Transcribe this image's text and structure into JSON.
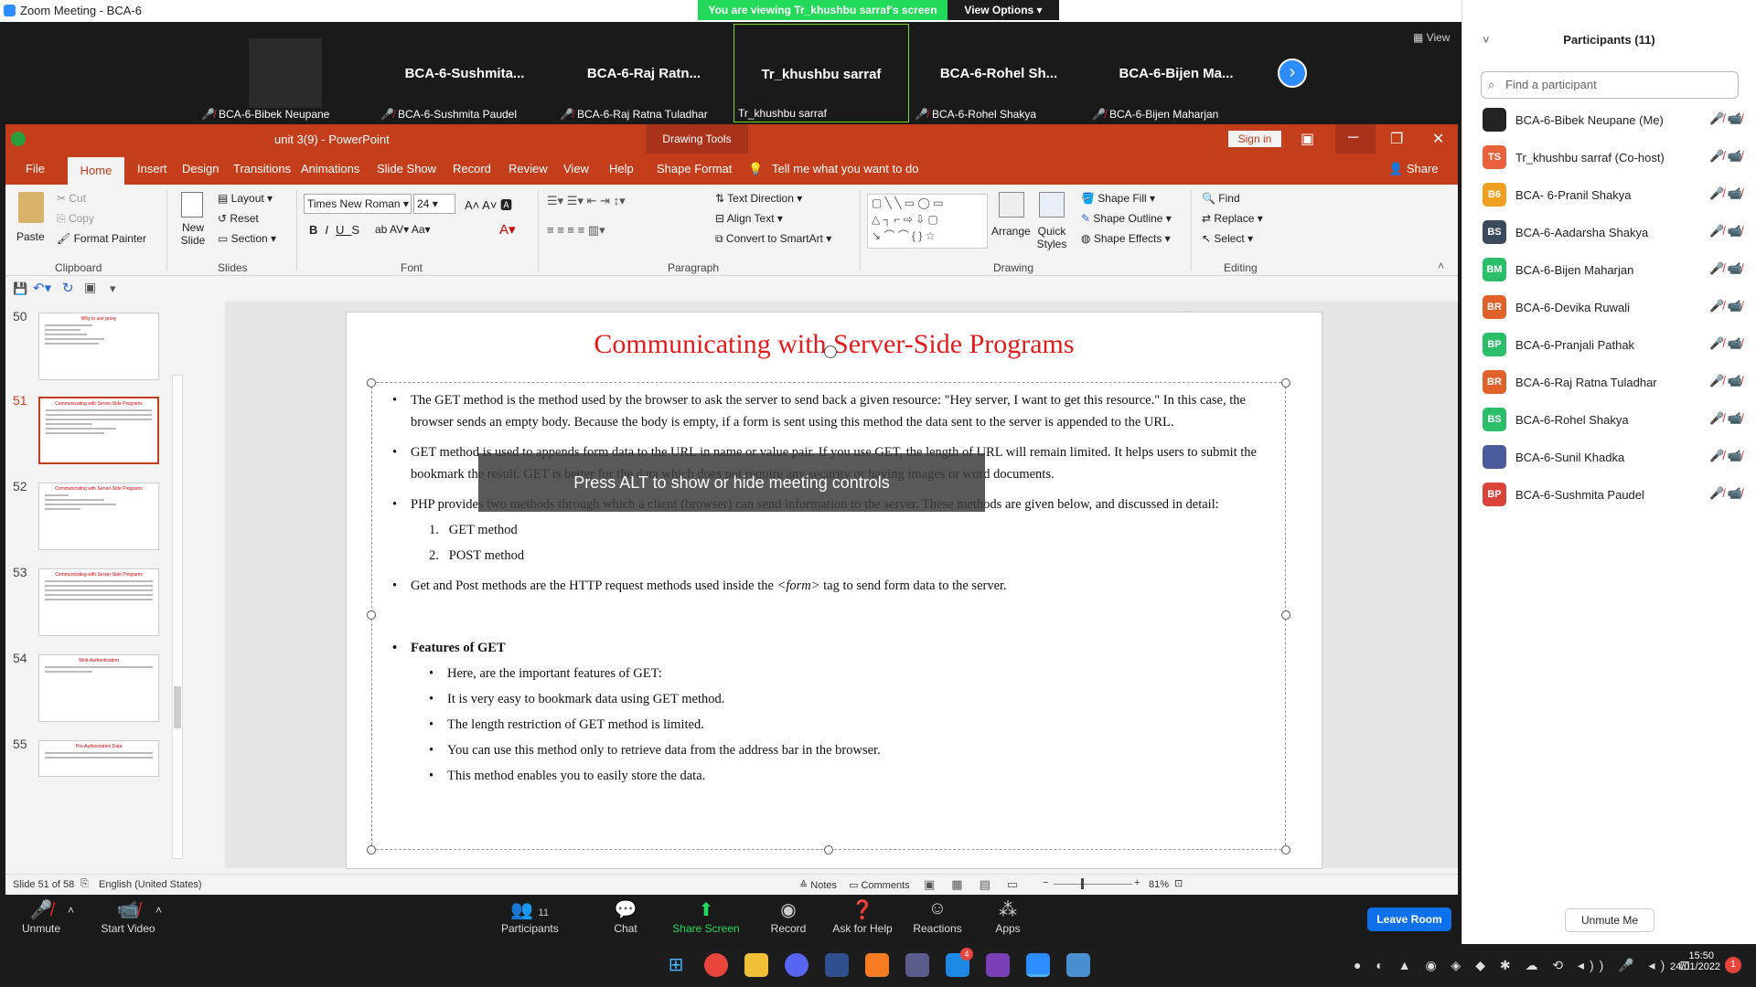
{
  "window": {
    "title": "Zoom Meeting - BCA-6",
    "viewing": "You are viewing Tr_khushbu sarraf's screen",
    "view_options": "View Options"
  },
  "gallery": {
    "tiles": [
      {
        "big": "",
        "name": "BCA-6-Bibek Neupane"
      },
      {
        "big": "BCA-6-Sushmita...",
        "name": "BCA-6-Sushmita Paudel"
      },
      {
        "big": "BCA-6-Raj  Ratn...",
        "name": "BCA-6-Raj Ratna Tuladhar"
      },
      {
        "big": "Tr_khushbu sarraf",
        "name": "Tr_khushbu sarraf"
      },
      {
        "big": "BCA-6-Rohel  Sh...",
        "name": "BCA-6-Rohel Shakya"
      },
      {
        "big": "BCA-6-Bijen  Ma...",
        "name": "BCA-6-Bijen Maharjan"
      }
    ],
    "view": "View"
  },
  "ppt": {
    "doc_title": "unit 3(9)  -  PowerPoint",
    "drawing_tools": "Drawing Tools",
    "sign_in": "Sign in",
    "tabs": [
      "File",
      "Home",
      "Insert",
      "Design",
      "Transitions",
      "Animations",
      "Slide Show",
      "Record",
      "Review",
      "View",
      "Help",
      "Shape Format"
    ],
    "tell_me": "Tell me what you want to do",
    "share": "Share",
    "ribbon": {
      "paste": "Paste",
      "cut": "Cut",
      "copy": "Copy",
      "format_painter": "Format Painter",
      "clipboard": "Clipboard",
      "new_slide": "New Slide",
      "layout": "Layout",
      "reset": "Reset",
      "section": "Section",
      "slides": "Slides",
      "font_name": "Times New Roman",
      "font_size": "24",
      "font": "Font",
      "text_direction": "Text Direction",
      "align_text": "Align Text",
      "convert": "Convert to SmartArt",
      "paragraph": "Paragraph",
      "arrange": "Arrange",
      "quick_styles": "Quick Styles",
      "shape_fill": "Shape Fill",
      "shape_outline": "Shape Outline",
      "shape_effects": "Shape Effects",
      "drawing": "Drawing",
      "find": "Find",
      "replace": "Replace",
      "select": "Select",
      "editing": "Editing"
    },
    "thumbs": [
      "50",
      "51",
      "52",
      "53",
      "54",
      "55"
    ],
    "thumb_titles": [
      "Why to use proxy",
      "Communicating with Server-Side Programs",
      "Communicating with Server-Side Programs",
      "Communicating with Server-Side Programs",
      "Web-Authentication",
      "Pre-Authorization Data"
    ],
    "slide": {
      "title": "Communicating with Server-Side Programs",
      "p1": "The GET method is the method used by the browser to ask the server to send back a given resource: \"Hey server, I want to get this resource.\" In this case, the browser sends an empty body. Because the body is empty, if a form is sent using this method the data sent to the server is appended to the URL.",
      "p2": "GET method is used to appends form data to the URL in name or value pair. If you use GET, the length of URL will remain limited. It helps users to submit the bookmark the result. GET is better for the data which does not require any security or having images or word documents.",
      "p3": "PHP provides two methods through which a client (browser) can send information to the server. These methods are given below, and discussed in detail:",
      "n1": "GET method",
      "n2": "POST method",
      "p4a": "Get and Post methods are the HTTP request methods used inside the ",
      "p4b": "<form>",
      "p4c": " tag to send form data to the server.",
      "features": "Features of GET",
      "f": [
        "Here, are the important features of GET:",
        "It is very easy to bookmark data using GET method.",
        "The length restriction of GET method is limited.",
        "You can use this method only to retrieve data from the address bar in the browser.",
        "This method enables you to easily store the data."
      ]
    },
    "overlay": "Press ALT to show or hide meeting controls",
    "status": {
      "slide": "Slide 51 of 58",
      "lang": "English (United States)",
      "notes": "Notes",
      "comments": "Comments",
      "zoom": "81%"
    }
  },
  "controls": {
    "unmute": "Unmute",
    "start_video": "Start Video",
    "participants": "Participants",
    "participants_count": "11",
    "chat": "Chat",
    "share": "Share Screen",
    "record": "Record",
    "help": "Ask for Help",
    "reactions": "Reactions",
    "apps": "Apps",
    "leave": "Leave Room"
  },
  "panel": {
    "title": "Participants (11)",
    "search": "Find a participant",
    "unmute_me": "Unmute Me",
    "people": [
      {
        "init": "",
        "name": "BCA-6-Bibek Neupane (Me)",
        "color": "#222222"
      },
      {
        "init": "TS",
        "name": "Tr_khushbu sarraf (Co-host)",
        "color": "#e8613a"
      },
      {
        "init": "B6",
        "name": "BCA- 6-Pranil Shakya",
        "color": "#f0a020"
      },
      {
        "init": "BS",
        "name": "BCA-6-Aadarsha Shakya",
        "color": "#3b4a5c"
      },
      {
        "init": "BM",
        "name": "BCA-6-Bijen Maharjan",
        "color": "#2cbf6a"
      },
      {
        "init": "BR",
        "name": "BCA-6-Devika Ruwali",
        "color": "#e0612a"
      },
      {
        "init": "BP",
        "name": "BCA-6-Pranjali Pathak",
        "color": "#2cbf6a"
      },
      {
        "init": "BR",
        "name": "BCA-6-Raj Ratna Tuladhar",
        "color": "#e0612a"
      },
      {
        "init": "BS",
        "name": "BCA-6-Rohel Shakya",
        "color": "#2cbf6a"
      },
      {
        "init": "",
        "name": "BCA-6-Sunil Khadka",
        "color": "#4a5a9a"
      },
      {
        "init": "BP",
        "name": "BCA-6-Sushmita Paudel",
        "color": "#d9433a"
      }
    ]
  },
  "taskbar": {
    "time": "15:50",
    "date": "24/01/2022",
    "badge": "1"
  }
}
